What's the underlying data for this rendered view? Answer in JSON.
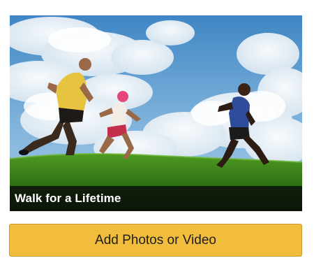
{
  "card": {
    "image_subject": "runners-on-grass-hill-photo",
    "caption": "Walk for a Lifetime"
  },
  "actions": {
    "add_media_label": "Add Photos or Video"
  },
  "colors": {
    "button_background": "#f2bd3c",
    "caption_background": "#0a0e08",
    "caption_text": "#ffffff"
  }
}
